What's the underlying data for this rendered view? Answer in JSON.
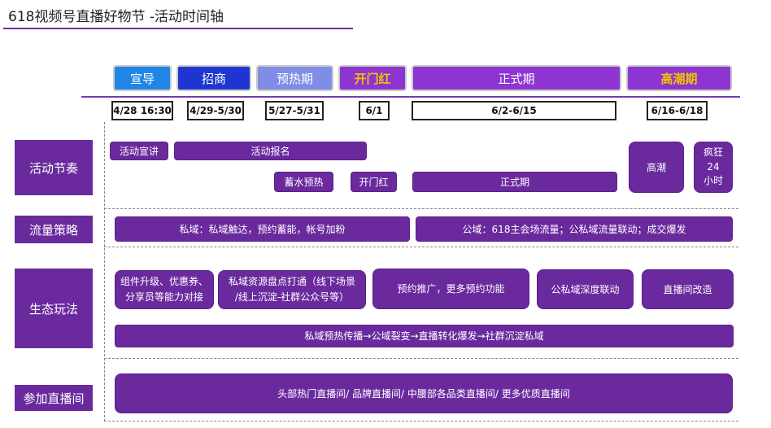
{
  "title": "618视频号直播好物节 -活动时间轴",
  "phases": [
    "宣导",
    "招商",
    "预热期",
    "开门红",
    "正式期",
    "高潮期"
  ],
  "dates": [
    "4/28 16:30",
    "4/29-5/30",
    "5/27-5/31",
    "6/1",
    "6/2-6/15",
    "6/16-6/18"
  ],
  "rows": {
    "rhythm": {
      "label": "活动节奏",
      "items": [
        "活动宣讲",
        "活动报名",
        "蓄水预热",
        "开门红",
        "正式期",
        "高潮"
      ],
      "crazy": [
        "疯狂",
        "24",
        "小时"
      ]
    },
    "traffic": {
      "label": "流量策略",
      "items": [
        "私域：私域触达，预约蓄能，帐号加粉",
        "公域：618主会场流量；公私域流量联动；成交爆发"
      ]
    },
    "ecology": {
      "label": "生态玩法",
      "box1": [
        "组件升级、优惠券、",
        "分享员等能力对接"
      ],
      "box2": [
        "私域资源盘点打通（线下场景",
        "/线上沉淀-社群公众号等）"
      ],
      "items": [
        "预约推广，更多预约功能",
        "公私域深度联动",
        "直播间改造"
      ],
      "flow": "私域预热传播→公域裂变→直播转化爆发→社群沉淀私域"
    },
    "rooms": {
      "label": "参加直播间",
      "text": "头部热门直播间/ 品牌直播间/ 中腰部各品类直播间/ 更多优质直播间"
    }
  },
  "colors": {
    "primary_purple": "#6a2a9e",
    "phase_purple": "#8e34d0",
    "phase_blue_light": "#1f86e6",
    "phase_blue": "#1f35d1",
    "phase_periwinkle": "#7f8de6",
    "highlight_gold": "#f5c400"
  }
}
